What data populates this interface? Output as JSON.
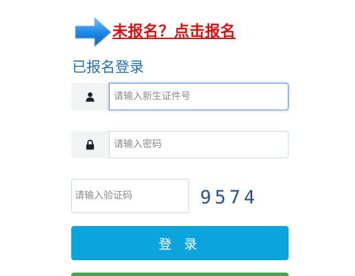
{
  "register_link": {
    "text": "未报名？点击报名",
    "color": "#e30c0c"
  },
  "arrow": {
    "icon": "arrow-right-icon",
    "color": "#1e88e5"
  },
  "login_title": "已报名登录",
  "student_id": {
    "icon": "user-icon",
    "placeholder": "请输入新生证件号",
    "value": ""
  },
  "password": {
    "icon": "lock-icon",
    "placeholder": "请输入密码",
    "value": ""
  },
  "captcha": {
    "placeholder": "请输入验证码",
    "code": "9574"
  },
  "login_button": {
    "label": "登 录",
    "color": "#0ca4dc"
  },
  "secondary_button": {
    "color": "#3fa84a"
  }
}
